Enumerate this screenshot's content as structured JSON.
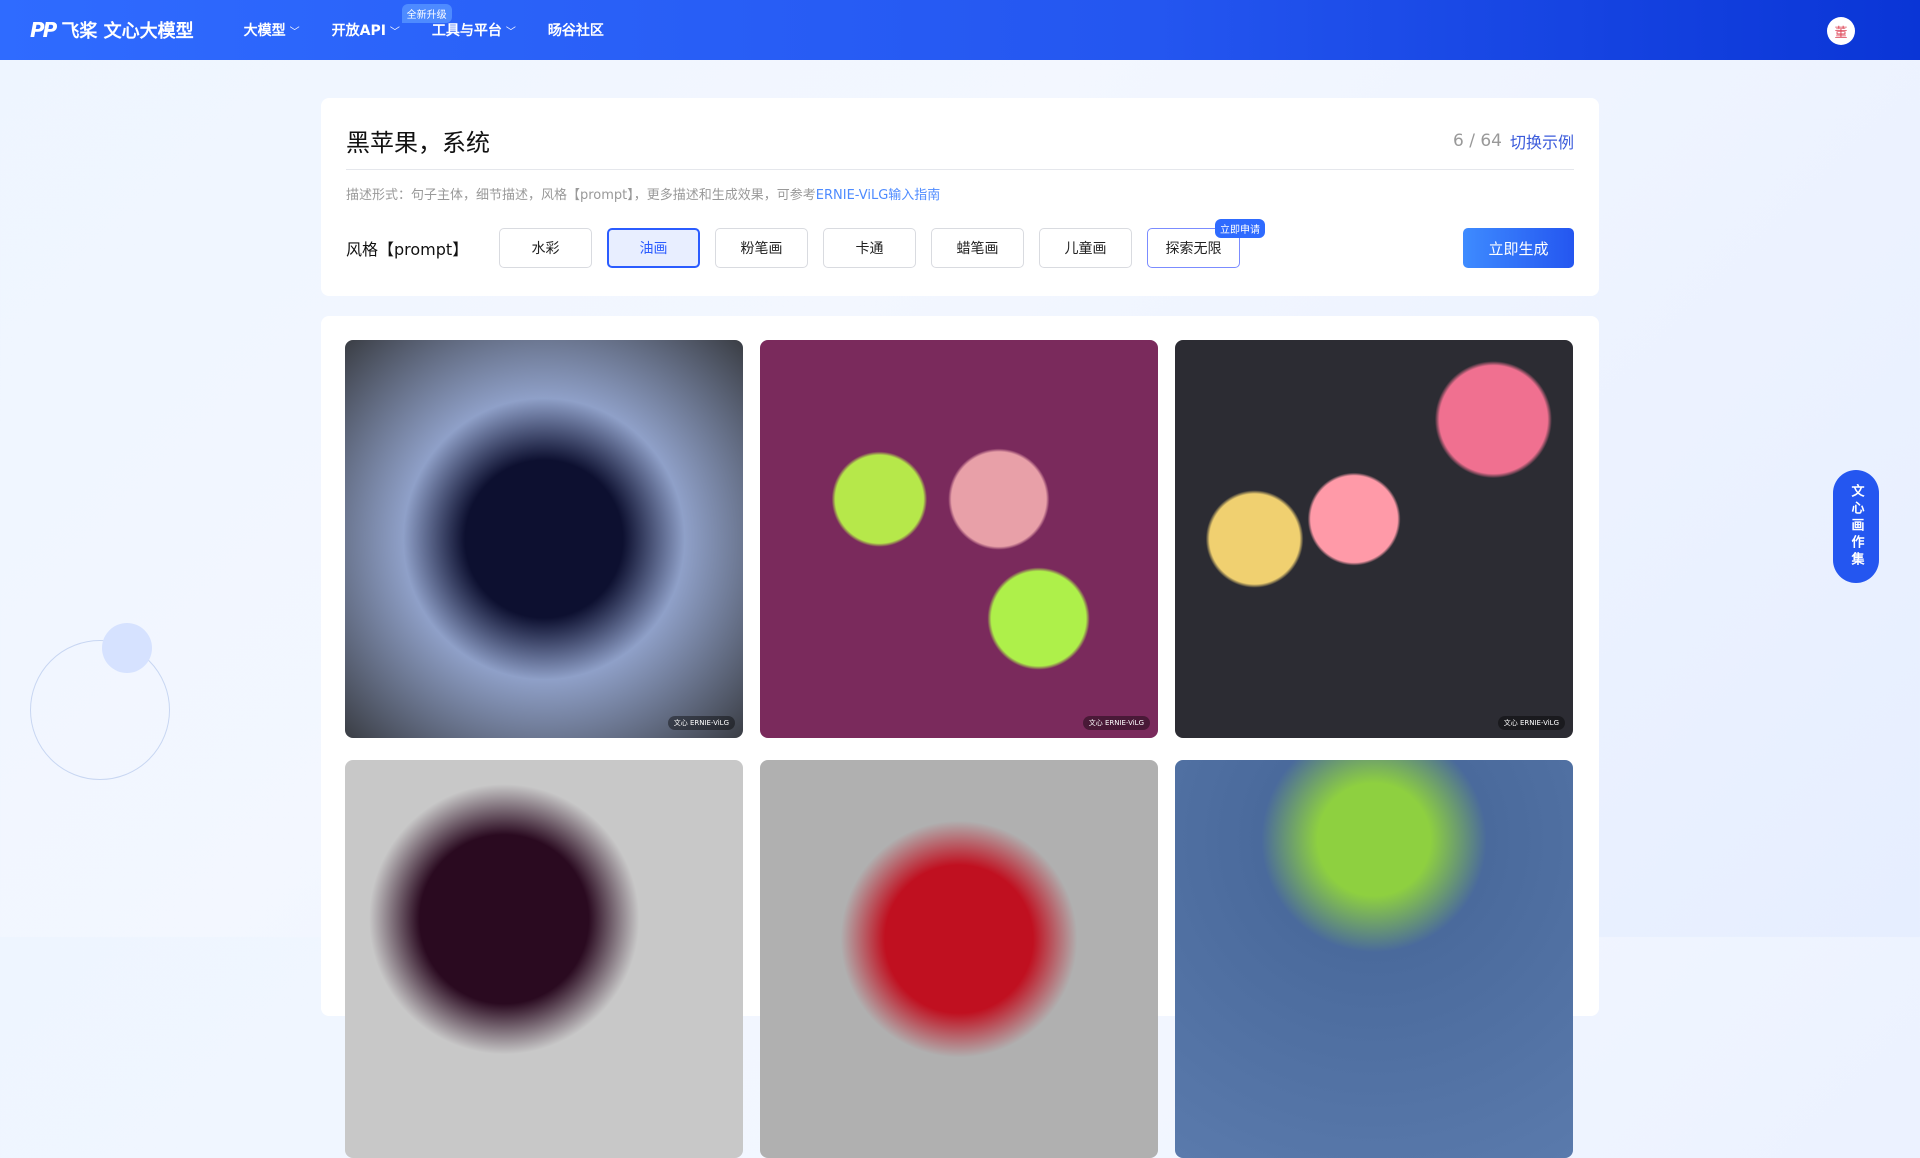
{
  "header": {
    "brand": "飞桨 文心大模型",
    "logo_mark": "PP",
    "nav": [
      {
        "label": "大模型",
        "chevron": true
      },
      {
        "label": "开放API",
        "chevron": true,
        "badge": "全新升级"
      },
      {
        "label": "工具与平台",
        "chevron": true
      },
      {
        "label": "旸谷社区"
      }
    ],
    "avatar": "董"
  },
  "prompt": {
    "value": "黑苹果，系统",
    "count": "6 / 64",
    "switch_label": "切换示例",
    "hint": "描述形式：句子主体，细节描述，风格【prompt】，更多描述和生成效果，可参考",
    "hint_link": "ERNIE-ViLG输入指南"
  },
  "style": {
    "label": "风格【prompt】",
    "options": [
      "水彩",
      "油画",
      "粉笔画",
      "卡通",
      "蜡笔画",
      "儿童画",
      "探索无限"
    ],
    "selected": "油画",
    "explore_badge": "立即申请",
    "generate_label": "立即生成"
  },
  "gallery": {
    "watermark": "文心 ERNIE-ViLG",
    "images": [
      "black apple with leaf",
      "apples on purple",
      "pink apples on dark",
      "dark apple on gray",
      "red apple",
      "green apple on blue"
    ]
  },
  "side_button": "文心画作集",
  "colors": {
    "accent": "#2456f0",
    "header": "#2f6bff"
  }
}
